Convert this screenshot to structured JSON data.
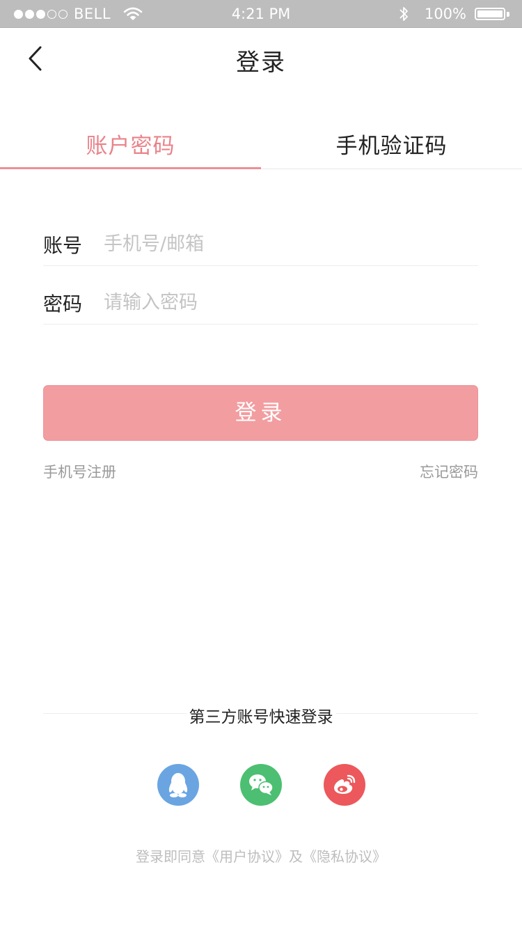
{
  "status_bar": {
    "carrier": "BELL",
    "time": "4:21 PM",
    "battery": "100%",
    "signal_strength": 3,
    "signal_total": 5
  },
  "nav": {
    "title": "登录"
  },
  "tabs": [
    {
      "label": "账户密码",
      "active": true
    },
    {
      "label": "手机验证码",
      "active": false
    }
  ],
  "form": {
    "account_label": "账号",
    "account_placeholder": "手机号/邮箱",
    "password_label": "密码",
    "password_placeholder": "请输入密码",
    "submit_label": "登录"
  },
  "links": {
    "register": "手机号注册",
    "forgot": "忘记密码"
  },
  "third_party": {
    "title": "第三方账号快速登录",
    "providers": [
      "qq-icon",
      "wechat-icon",
      "weibo-icon"
    ]
  },
  "agreement": {
    "prefix": "登录即同意",
    "user_agreement": "《用户协议》",
    "connector": "及",
    "privacy_policy": "《隐私协议》"
  },
  "colors": {
    "accent": "#e9838a",
    "button": "#f29da0",
    "qq": "#6aa5e2",
    "wechat": "#4cbf72",
    "weibo": "#ec585b"
  }
}
